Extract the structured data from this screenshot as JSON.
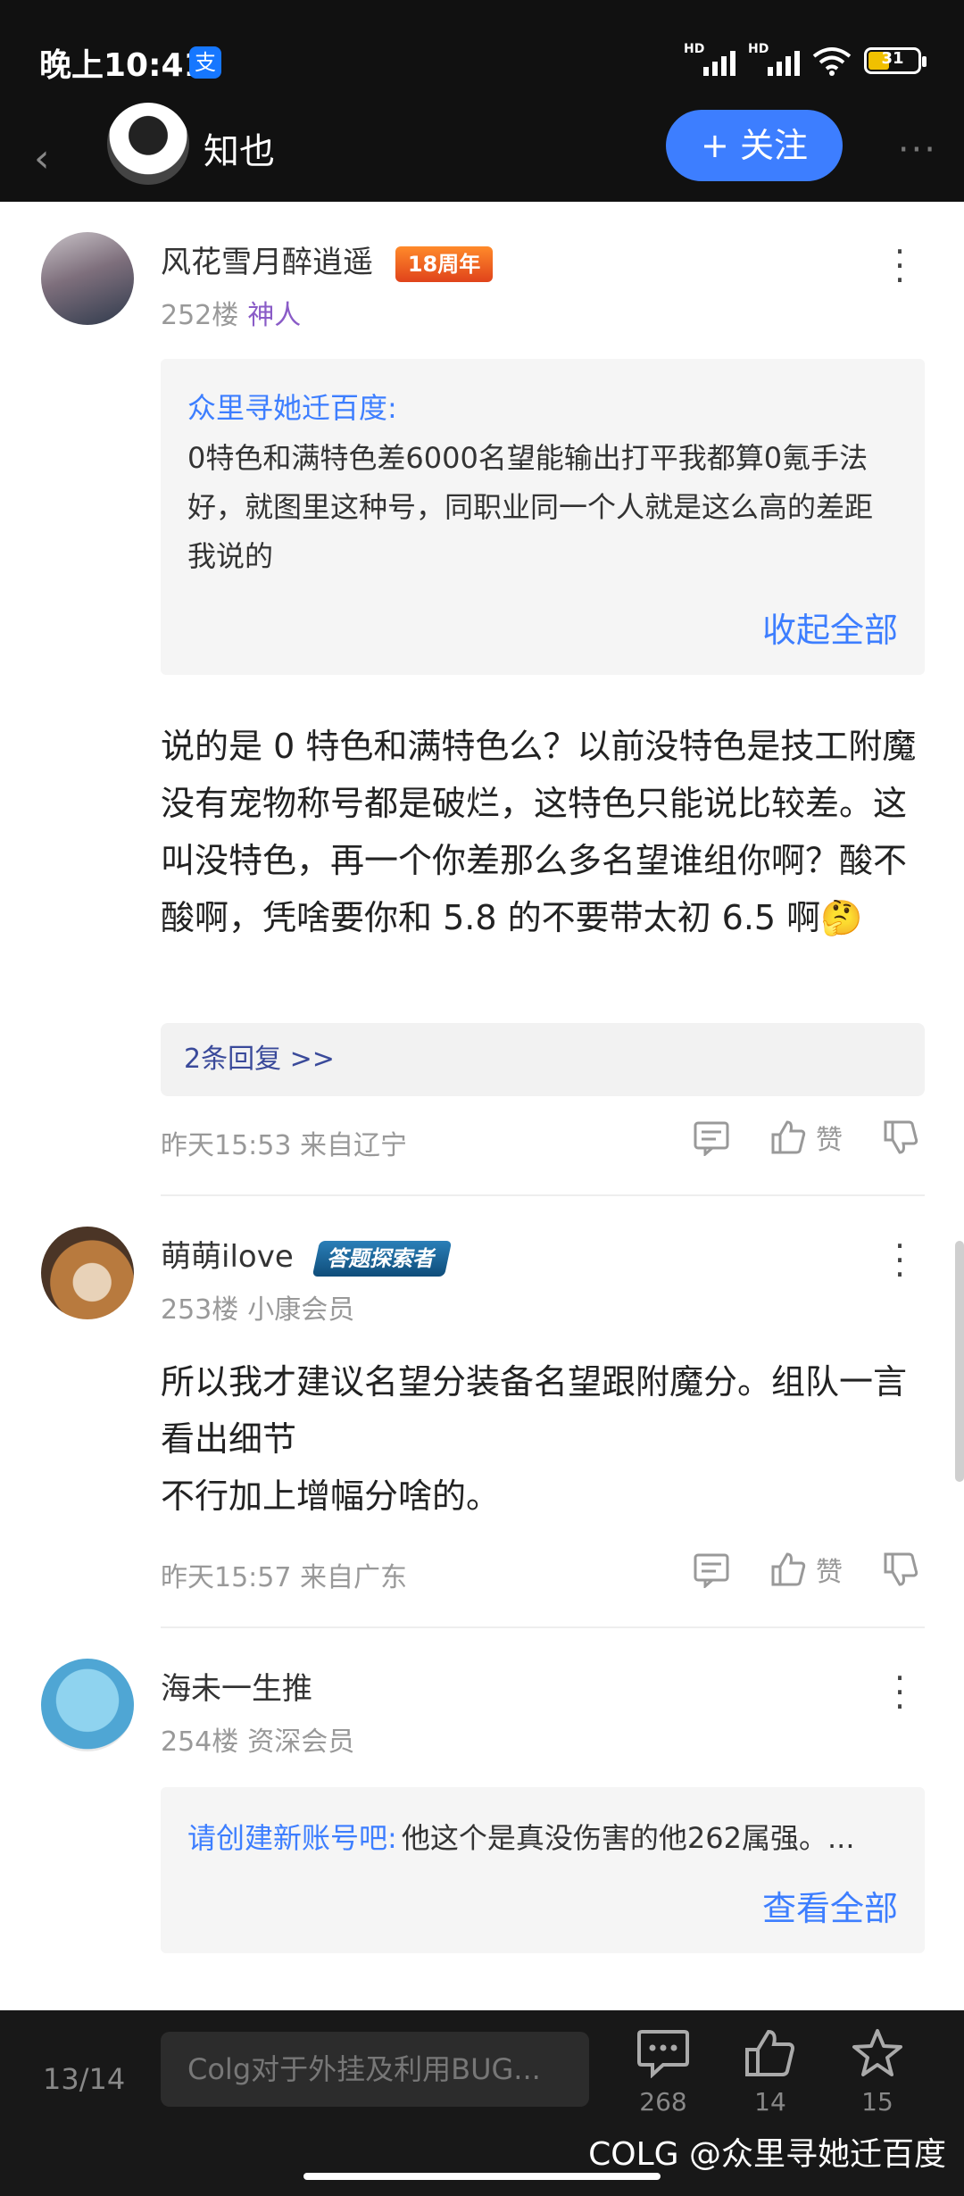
{
  "status_bar": {
    "time": "晚上10:41",
    "alipay": "支",
    "battery": "31"
  },
  "header": {
    "back": "‹",
    "title": "知也",
    "follow_label": "+ 关注",
    "more": "···"
  },
  "comments": [
    {
      "author": "风花雪月醉逍遥",
      "badge": "18周年",
      "floor": "252楼",
      "rank": "神人",
      "quote_user": "众里寻她迁百度:",
      "quote_text": "0特色和满特色差6000名望能输出打平我都算0氪手法好，就图里这种号，同职业同一个人就是这么高的差距我说的",
      "quote_toggle": "收起全部",
      "body": "说的是 0 特色和满特色么？以前没特色是技工附魔没有宠物称号都是破烂，这特色只能说比较差。这叫没特色，再一个你差那么多名望谁组你啊？酸不酸啊，凭啥要你和 5.8 的不要带太初 6.5 啊🤔",
      "replies": "2条回复 >>",
      "meta": "昨天15:53 来自辽宁",
      "like": "赞"
    },
    {
      "author": "萌萌ilove",
      "badge": "答题探索者",
      "floor": "253楼",
      "rank": "小康会员",
      "body_line1": "所以我才建议名望分装备名望跟附魔分。组队一言看出细节",
      "body_line2": "不行加上增幅分啥的。",
      "meta": "昨天15:57 来自广东",
      "like": "赞"
    },
    {
      "author": "海未一生推",
      "floor": "254楼",
      "rank": "资深会员",
      "quote_user": "请创建新账号吧:",
      "quote_text": "他这个是真没伤害的他262属强。...",
      "quote_toggle": "查看全部"
    }
  ],
  "bottom_bar": {
    "page": "13/14",
    "input_placeholder": "Colg对于外挂及利用BUG...",
    "comment_count": "268",
    "like_count": "14",
    "fav_count": "15"
  },
  "watermark": "COLG @众里寻她迁百度",
  "colors": {
    "accent": "#3d7eff",
    "dark_bg": "#111111",
    "muted": "#999999"
  }
}
